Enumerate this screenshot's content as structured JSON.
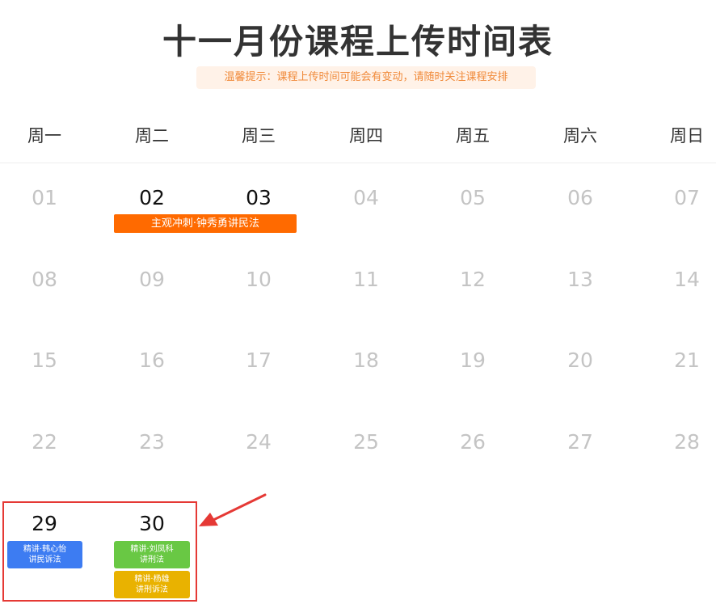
{
  "title": "十一月份课程上传时间表",
  "hint": "温馨提示：课程上传时间可能会有变动，请随时关注课程安排",
  "weekdays": [
    "周一",
    "周二",
    "周三",
    "周四",
    "周五",
    "周六",
    "周日"
  ],
  "weeks": [
    [
      "01",
      "02",
      "03",
      "04",
      "05",
      "06",
      "07"
    ],
    [
      "08",
      "09",
      "10",
      "11",
      "12",
      "13",
      "14"
    ],
    [
      "15",
      "16",
      "17",
      "18",
      "19",
      "20",
      "21"
    ],
    [
      "22",
      "23",
      "24",
      "25",
      "26",
      "27",
      "28"
    ],
    [
      "29",
      "30"
    ]
  ],
  "active_days": [
    "02",
    "03",
    "29",
    "30"
  ],
  "events": {
    "e1": {
      "label": "主观冲刺·钟秀勇讲民法",
      "color": "#ff6a00"
    },
    "e2": {
      "line1": "精讲·韩心怡",
      "line2": "讲民诉法",
      "color": "#3d7cf2"
    },
    "e3": {
      "line1": "精讲·刘凤科",
      "line2": "讲刑法",
      "color": "#69c844"
    },
    "e4": {
      "line1": "精讲·杨雄",
      "line2": "讲刑诉法",
      "color": "#e9b200"
    }
  },
  "annotation_color": "#e53935"
}
